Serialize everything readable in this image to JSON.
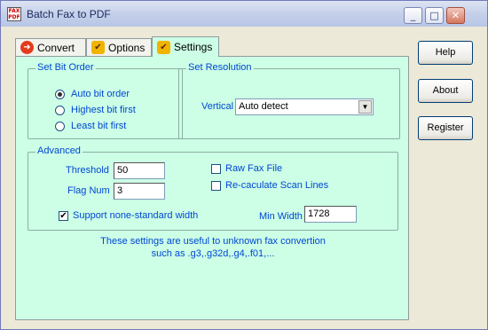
{
  "window": {
    "title": "Batch Fax to PDF",
    "icon_text": "FAX PDF",
    "controls": {
      "minimize": "_",
      "maximize": "□",
      "close": "✕"
    }
  },
  "tabs": [
    {
      "label": "Convert",
      "icon": "arrow-right-icon",
      "color": "#e33c1b"
    },
    {
      "label": "Options",
      "icon": "checklist-icon",
      "color": "#f0b400"
    },
    {
      "label": "Settings",
      "icon": "checklist-icon",
      "color": "#f0b400",
      "active": true
    }
  ],
  "bit_order": {
    "title": "Set Bit Order",
    "options": [
      "Auto bit order",
      "Highest bit first",
      "Least bit first"
    ],
    "selected": "Auto bit order"
  },
  "resolution": {
    "title": "Set Resolution",
    "vertical_label": "Vertical",
    "vertical_value": "Auto detect"
  },
  "advanced": {
    "title": "Advanced",
    "threshold_label": "Threshold",
    "threshold_value": "50",
    "flag_num_label": "Flag Num",
    "flag_num_value": "3",
    "raw_fax_label": "Raw Fax File",
    "raw_fax_checked": false,
    "recalc_label": "Re-caculate Scan Lines",
    "recalc_checked": false,
    "support_label": "Support none-standard width",
    "support_checked": true,
    "min_width_label": "Min Width",
    "min_width_value": "1728"
  },
  "note": {
    "line1": "These settings are useful to unknown fax convertion",
    "line2": "such as .g3,.g32d,.g4,.f01,..."
  },
  "buttons": {
    "help": "Help",
    "about": "About",
    "register": "Register"
  },
  "colors": {
    "panel_bg": "#ccffe6",
    "label_blue": "#0046d5",
    "window_bg": "#ece9d8"
  }
}
